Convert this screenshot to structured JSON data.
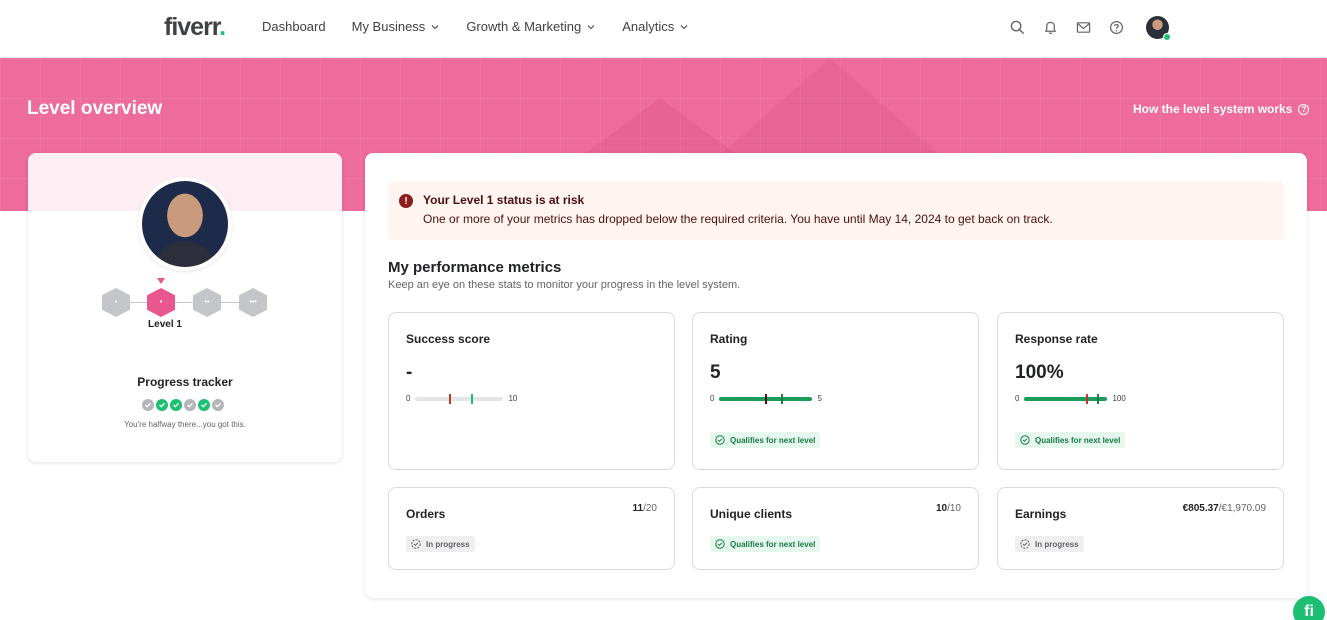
{
  "nav": {
    "logo": "fiverr",
    "items": [
      {
        "label": "Dashboard",
        "dropdown": false
      },
      {
        "label": "My Business",
        "dropdown": true
      },
      {
        "label": "Growth & Marketing",
        "dropdown": true
      },
      {
        "label": "Analytics",
        "dropdown": true
      }
    ],
    "icons": [
      "search-icon",
      "bell-icon",
      "mail-icon",
      "help-icon"
    ]
  },
  "banner": {
    "title": "Level overview",
    "link": "How the level system works"
  },
  "profile": {
    "level_label": "Level 1",
    "tracker_title": "Progress tracker",
    "tracker_sub": "You're halfway there...you got this.",
    "tracker_steps": [
      "pending",
      "done",
      "done",
      "pending",
      "done",
      "pending"
    ]
  },
  "alert": {
    "title": "Your Level 1 status is at risk",
    "message": "One or more of your metrics has dropped below the required criteria. You have until May 14, 2024 to get back on track."
  },
  "metrics_section": {
    "title": "My performance metrics",
    "subtitle": "Keep an eye on these stats to monitor your progress in the level system."
  },
  "metrics": {
    "success": {
      "title": "Success score",
      "value": "-",
      "min": "0",
      "max": "10"
    },
    "rating": {
      "title": "Rating",
      "value": "5",
      "min": "0",
      "max": "5",
      "badge": "Qualifies for next level"
    },
    "response": {
      "title": "Response rate",
      "value": "100%",
      "min": "0",
      "max": "100",
      "badge": "Qualifies for next level"
    },
    "orders": {
      "title": "Orders",
      "current": "11",
      "target": "/20",
      "badge": "In progress"
    },
    "clients": {
      "title": "Unique clients",
      "current": "10",
      "target": "/10",
      "badge": "Qualifies for next level"
    },
    "earnings": {
      "title": "Earnings",
      "current": "€805.37",
      "target": "/€1,970.09",
      "badge": "In progress"
    }
  },
  "colors": {
    "brand_green": "#1dbf73",
    "banner_pink": "#ee6c9b",
    "level_pink": "#e8588e",
    "alert_bg": "#fff4ef",
    "alert_text": "#4a1010"
  },
  "bubble": {
    "label": "fi"
  }
}
